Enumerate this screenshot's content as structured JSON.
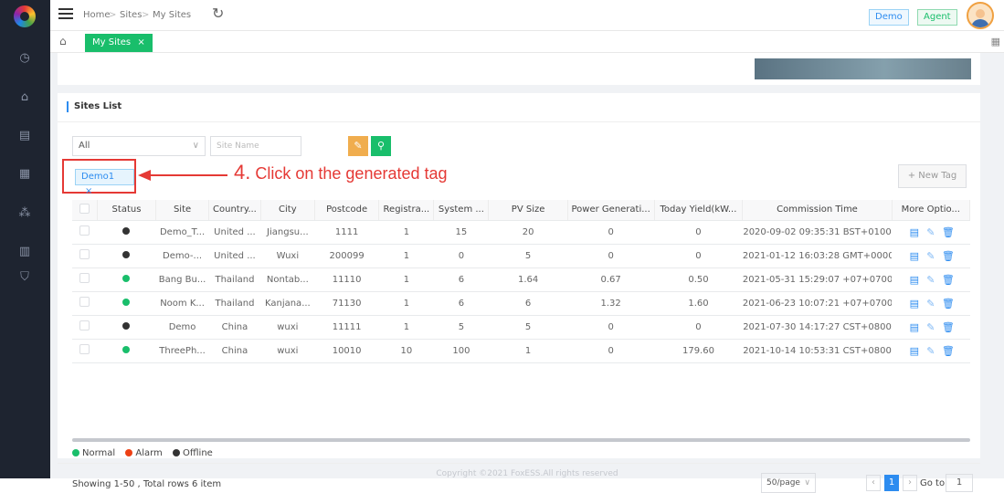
{
  "breadcrumb": [
    "Home",
    "Sites",
    "My Sites"
  ],
  "roles": {
    "demo": "Demo",
    "agent": "Agent"
  },
  "tab": {
    "label": "My Sites"
  },
  "sites_list": {
    "title": "Sites List"
  },
  "filters": {
    "select_value": "All",
    "site_name_placeholder": "Site Name"
  },
  "tag": {
    "label": "Demo1"
  },
  "annotation": {
    "number": "4.",
    "text": "Click on the generated tag"
  },
  "new_tag_label": "+ New Tag",
  "table": {
    "headers": [
      "",
      "Status",
      "Site",
      "Country...",
      "City",
      "Postcode",
      "Registra...",
      "System ...",
      "PV Size",
      "Power Generati...",
      "Today Yield(kW...",
      "Commission Time",
      "More Optio..."
    ],
    "rows": [
      {
        "status": "offline",
        "site": "Demo_T...",
        "country": "United ...",
        "city": "Jiangsu...",
        "postcode": "1111",
        "reg": "1",
        "system": "15",
        "pv": "20",
        "power": "0",
        "yield": "0",
        "time": "2020-09-02 09:35:31 BST+0100"
      },
      {
        "status": "offline",
        "site": "Demo-...",
        "country": "United ...",
        "city": "Wuxi",
        "postcode": "200099",
        "reg": "1",
        "system": "0",
        "pv": "5",
        "power": "0",
        "yield": "0",
        "time": "2021-01-12 16:03:28 GMT+0000"
      },
      {
        "status": "normal",
        "site": "Bang Bu...",
        "country": "Thailand",
        "city": "Nontab...",
        "postcode": "11110",
        "reg": "1",
        "system": "6",
        "pv": "1.64",
        "power": "0.67",
        "yield": "0.50",
        "time": "2021-05-31 15:29:07 +07+0700"
      },
      {
        "status": "normal",
        "site": "Noom K...",
        "country": "Thailand",
        "city": "Kanjana...",
        "postcode": "71130",
        "reg": "1",
        "system": "6",
        "pv": "6",
        "power": "1.32",
        "yield": "1.60",
        "time": "2021-06-23 10:07:21 +07+0700"
      },
      {
        "status": "offline",
        "site": "Demo",
        "country": "China",
        "city": "wuxi",
        "postcode": "11111",
        "reg": "1",
        "system": "5",
        "pv": "5",
        "power": "0",
        "yield": "0",
        "time": "2021-07-30 14:17:27 CST+0800"
      },
      {
        "status": "normal",
        "site": "ThreePh...",
        "country": "China",
        "city": "wuxi",
        "postcode": "10010",
        "reg": "10",
        "system": "100",
        "pv": "1",
        "power": "0",
        "yield": "179.60",
        "time": "2021-10-14 10:53:31 CST+0800"
      }
    ]
  },
  "legend": {
    "normal": "Normal",
    "alarm": "Alarm",
    "offline": "Offline",
    "normal_color": "#19be6b",
    "alarm_color": "#ed4014",
    "offline_color": "#333333"
  },
  "pagination": {
    "showing": "Showing 1-50 , Total rows 6 item",
    "page_size": "50/page",
    "current_page": "1",
    "goto_label": "Go to",
    "goto_value": "1"
  },
  "copyright": "Copyright ©2021 FoxESS.All rights reserved"
}
